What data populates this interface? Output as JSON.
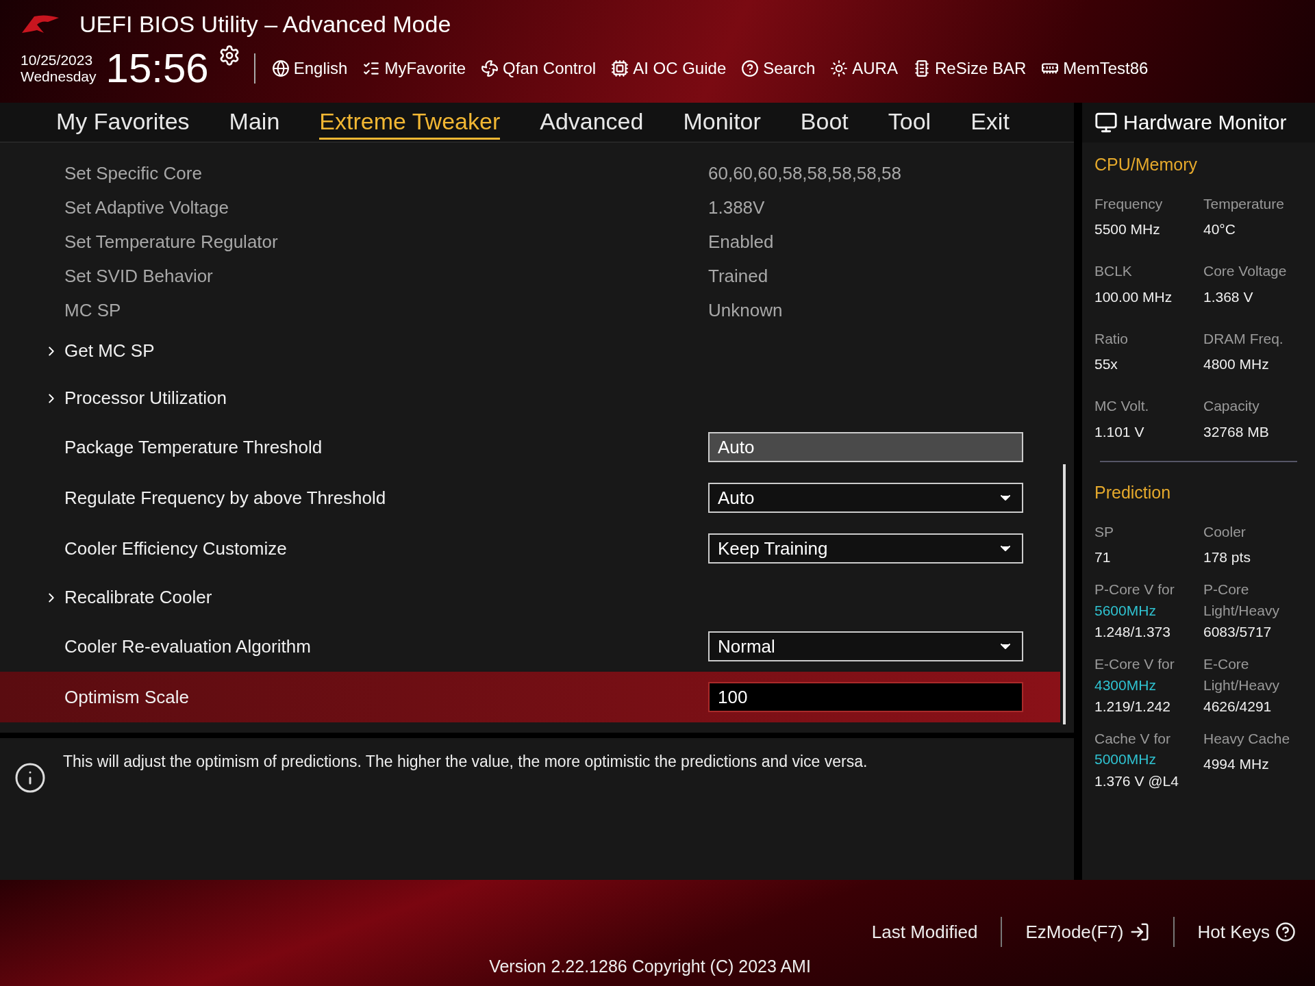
{
  "header": {
    "title": "UEFI BIOS Utility – Advanced Mode",
    "date": "10/25/2023",
    "weekday": "Wednesday",
    "time": "15:56",
    "toolbar": [
      {
        "kind": "globe",
        "label": "English"
      },
      {
        "kind": "list",
        "label": "MyFavorite"
      },
      {
        "kind": "fan",
        "label": "Qfan Control"
      },
      {
        "kind": "chip",
        "label": "AI OC Guide"
      },
      {
        "kind": "help",
        "label": "Search"
      },
      {
        "kind": "light",
        "label": "AURA"
      },
      {
        "kind": "card",
        "label": "ReSize BAR"
      },
      {
        "kind": "memory",
        "label": "MemTest86"
      }
    ]
  },
  "tabs": [
    {
      "label": "My Favorites",
      "selected": false
    },
    {
      "label": "Main",
      "selected": false
    },
    {
      "label": "Extreme Tweaker",
      "selected": true
    },
    {
      "label": "Advanced",
      "selected": false
    },
    {
      "label": "Monitor",
      "selected": false
    },
    {
      "label": "Boot",
      "selected": false
    },
    {
      "label": "Tool",
      "selected": false
    },
    {
      "label": "Exit",
      "selected": false
    }
  ],
  "settings": [
    {
      "kind": "info",
      "label": "Set Specific Core",
      "value": "60,60,60,58,58,58,58,58",
      "selected": false
    },
    {
      "kind": "info",
      "label": "Set Adaptive Voltage",
      "value": "1.388V",
      "selected": false
    },
    {
      "kind": "info",
      "label": "Set Temperature Regulator",
      "value": "Enabled",
      "selected": false
    },
    {
      "kind": "info",
      "label": "Set SVID Behavior",
      "value": "Trained",
      "selected": false
    },
    {
      "kind": "info",
      "label": "MC SP",
      "value": "Unknown",
      "selected": false
    },
    {
      "kind": "submenu",
      "label": "Get MC SP",
      "selected": false
    },
    {
      "kind": "submenu",
      "label": "Processor Utilization",
      "selected": false
    },
    {
      "kind": "textbox",
      "label": "Package Temperature Threshold",
      "value": "Auto",
      "selected": false
    },
    {
      "kind": "dropdown",
      "label": "Regulate Frequency by above Threshold",
      "value": "Auto",
      "selected": false
    },
    {
      "kind": "dropdown",
      "label": "Cooler Efficiency Customize",
      "value": "Keep Training",
      "selected": false
    },
    {
      "kind": "submenu",
      "label": "Recalibrate Cooler",
      "selected": false
    },
    {
      "kind": "dropdown",
      "label": "Cooler Re-evaluation Algorithm",
      "value": "Normal",
      "selected": false
    },
    {
      "kind": "textbox",
      "label": "Optimism Scale",
      "value": "100",
      "selected": true
    }
  ],
  "help_text": "This will adjust the optimism of predictions. The higher the value, the more optimistic the predictions and vice versa.",
  "hardware_monitor": {
    "title": "Hardware Monitor",
    "sections": [
      {
        "title": "CPU/Memory",
        "items": [
          {
            "label": "Frequency",
            "value": "5500 MHz"
          },
          {
            "label": "Temperature",
            "value": "40°C"
          },
          {
            "label": "BCLK",
            "value": "100.00 MHz"
          },
          {
            "label": "Core Voltage",
            "value": "1.368 V"
          },
          {
            "label": "Ratio",
            "value": "55x"
          },
          {
            "label": "DRAM Freq.",
            "value": "4800 MHz"
          },
          {
            "label": "MC Volt.",
            "value": "1.101 V"
          },
          {
            "label": "Capacity",
            "value": "32768 MB"
          }
        ]
      },
      {
        "title": "Prediction",
        "items": [
          {
            "label": "SP",
            "value": "71"
          },
          {
            "label": "Cooler",
            "value": "178 pts"
          },
          {
            "label": "P-Core V for",
            "sublabel": {
              "text": "5600MHz",
              "highlight": true
            },
            "value": "1.248/1.373"
          },
          {
            "label": "P-Core",
            "sublabel": {
              "text": "Light/Heavy",
              "highlight": false
            },
            "value": "6083/5717"
          },
          {
            "label": "E-Core V for",
            "sublabel": {
              "text": "4300MHz",
              "highlight": true
            },
            "value": "1.219/1.242"
          },
          {
            "label": "E-Core",
            "sublabel": {
              "text": "Light/Heavy",
              "highlight": false
            },
            "value": "4626/4291"
          },
          {
            "label": "Cache V for",
            "sublabel": {
              "text": "5000MHz",
              "highlight": true
            },
            "value": "1.376 V @L4"
          },
          {
            "label": "Heavy Cache",
            "value": "4994 MHz"
          }
        ]
      }
    ]
  },
  "footer": {
    "actions": [
      {
        "kind": "plain",
        "label": "Last Modified"
      },
      {
        "kind": "exit",
        "label": "EzMode(F7)"
      },
      {
        "kind": "help",
        "label": "Hot Keys"
      }
    ],
    "version": "Version 2.22.1286 Copyright (C) 2023 AMI"
  }
}
